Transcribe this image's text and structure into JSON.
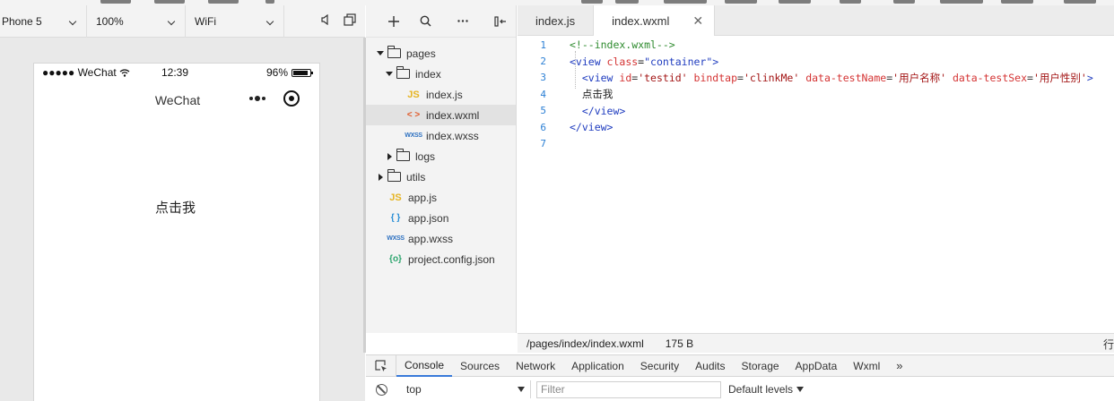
{
  "simulator": {
    "device": "Phone 5",
    "zoom": "100%",
    "network": "WiFi",
    "status_bar": {
      "carrier": "●●●●● WeChat",
      "time": "12:39",
      "battery": "96%"
    },
    "nav_title": "WeChat",
    "page_text": "点击我"
  },
  "file_tree": {
    "items": [
      {
        "label": "pages"
      },
      {
        "label": "index"
      },
      {
        "label": "index.js"
      },
      {
        "label": "index.wxml"
      },
      {
        "label": "index.wxss"
      },
      {
        "label": "logs"
      },
      {
        "label": "utils"
      },
      {
        "label": "app.js"
      },
      {
        "label": "app.json"
      },
      {
        "label": "app.wxss"
      },
      {
        "label": "project.config.json"
      }
    ]
  },
  "editor": {
    "tabs": [
      {
        "label": "index.js"
      },
      {
        "label": "index.wxml"
      }
    ],
    "lines": [
      {
        "num": "1",
        "comment": "<!--index.wxml-->"
      },
      {
        "num": "2",
        "open": "<view ",
        "attr": "class",
        "eq": "=",
        "val": "\"container\"",
        "close": ">"
      },
      {
        "num": "3",
        "open": "<view ",
        "a1": "id",
        "v1": "'testid'",
        "a2": "bindtap",
        "v2": "'clinkMe'",
        "a3": "data-testName",
        "v3": "'用户名称'",
        "a4": "data-testSex",
        "v4": "'用户性别'",
        "close": ">"
      },
      {
        "num": "4",
        "text": "点击我"
      },
      {
        "num": "5",
        "tag": "</view>"
      },
      {
        "num": "6",
        "tag": "</view>"
      },
      {
        "num": "7"
      }
    ],
    "status": {
      "path": "/pages/index/index.wxml",
      "size": "175 B",
      "trail": "行"
    }
  },
  "devtools": {
    "tabs": [
      {
        "label": "Console"
      },
      {
        "label": "Sources"
      },
      {
        "label": "Network"
      },
      {
        "label": "Application"
      },
      {
        "label": "Security"
      },
      {
        "label": "Audits"
      },
      {
        "label": "Storage"
      },
      {
        "label": "AppData"
      },
      {
        "label": "Wxml"
      }
    ],
    "more": "»",
    "context": "top",
    "filter_placeholder": "Filter",
    "levels": "Default levels"
  }
}
